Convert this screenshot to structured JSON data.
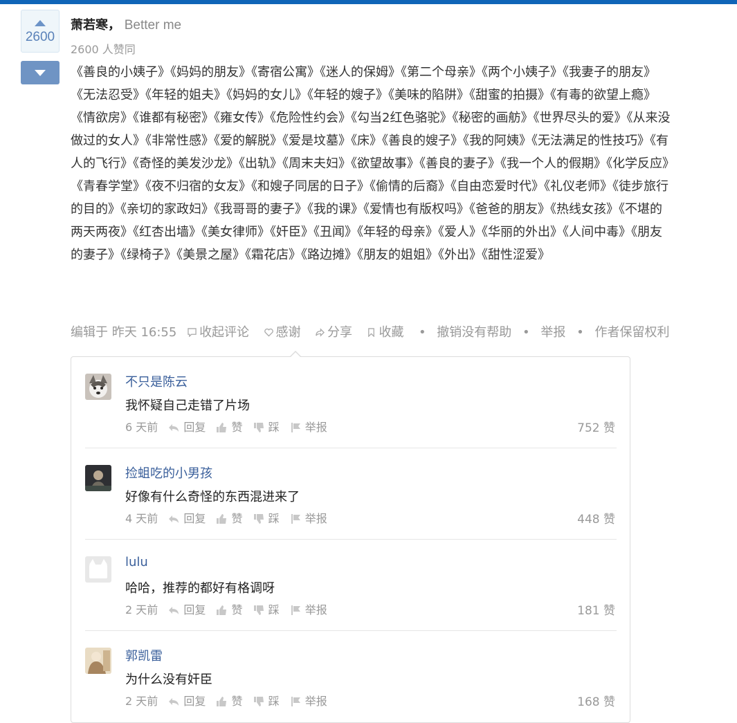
{
  "answer": {
    "votes": "2600",
    "author_name": "萧若寒，",
    "author_bio": "Better me",
    "approve_text": "2600 人赞同",
    "content": "《善良的小姨子》《妈妈的朋友》《寄宿公寓》《迷人的保姆》《第二个母亲》《两个小姨子》《我妻子的朋友》《无法忍受》《年轻的姐夫》《妈妈的女儿》《年轻的嫂子》《美味的陷阱》《甜蜜的拍摄》《有毒的欲望上瘾》《情欲房》《谁都有秘密》《雍女传》《危险性约会》《勾当2红色骆驼》《秘密的画舫》《世界尽头的爱》《从来没做过的女人》《非常性感》《爱的解脱》《爱是坟墓》《床》《善良的嫂子》《我的阿姨》《无法满足的性技巧》《有人的飞行》《奇怪的美发沙龙》《出轨》《周末夫妇》《欲望故事》《善良的妻子》《我一个人的假期》《化学反应》《青春学堂》《夜不归宿的女友》《和嫂子同居的日子》《偷情的后裔》《自由恋爱时代》《礼仪老师》《徒步旅行的目的》《亲切的家政妇》《我哥哥的妻子》《我的课》《爱情也有版权吗》《爸爸的朋友》《热线女孩》《不堪的两天两夜》《红杏出墙》《美女律师》《奸臣》《丑闻》《年轻的母亲》《爱人》《华丽的外出》《人间中毒》《朋友的妻子》《绿椅子》《美景之屋》《霜花店》《路边摊》《朋友的姐姐》《外出》《甜性涩爱》"
  },
  "actions": {
    "edited": "编辑于 昨天 16:55",
    "collapse_comments": "收起评论",
    "thanks": "感谢",
    "share": "分享",
    "collect": "收藏",
    "bullet": "•",
    "unhelpful": "撤销没有帮助",
    "report": "举报",
    "rights": "作者保留权利"
  },
  "comment_labels": {
    "reply": "回复",
    "like": "赞",
    "dislike": "踩",
    "report": "举报"
  },
  "comments": [
    {
      "name": "不只是陈云",
      "text": "我怀疑自己走错了片场",
      "time": "6 天前",
      "likes": "752 赞"
    },
    {
      "name": "捡蛆吃的小男孩",
      "text": "好像有什么奇怪的东西混进来了",
      "time": "4 天前",
      "likes": "448 赞"
    },
    {
      "name": "lulu",
      "text": "哈哈，推荐的都好有格调呀",
      "time": "2 天前",
      "likes": "181 赞"
    },
    {
      "name": "郭凯雷",
      "text": "为什么没有奸臣",
      "time": "2 天前",
      "likes": "168 赞"
    }
  ],
  "colors": {
    "brand_bar": "#0f65b8",
    "vote_down": "#6f94c4",
    "link": "#3a5f9b"
  }
}
